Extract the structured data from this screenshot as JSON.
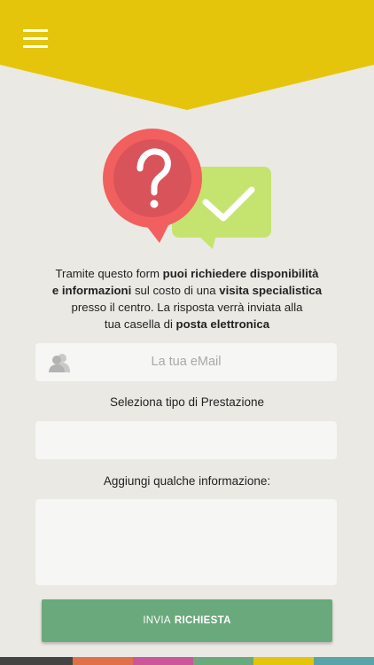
{
  "colors": {
    "header": "#e5c50c",
    "background": "#ebe9e3",
    "field_bg": "#f6f6f5",
    "button": "#6aa97c",
    "bubble_red": "#f25f5f",
    "bubble_green": "#c4e46f",
    "strip": [
      "#444444",
      "#e0704a",
      "#c9579a",
      "#69a97b",
      "#e5c50c",
      "#5aa3a6"
    ]
  },
  "header": {
    "menu_icon": "hamburger-menu-icon"
  },
  "intro": {
    "part1": "Tramite questo form ",
    "bold1": "puoi richiedere disponibilità",
    "bold2": "e informazioni",
    "part2": " sul costo di una ",
    "bold3": "visita specialistica",
    "part3": "presso il centro. La risposta verrà inviata alla",
    "part4": "tua casella di ",
    "bold4": "posta elettronica"
  },
  "form": {
    "email_placeholder": "La tua eMail",
    "prestazione_label": "Seleziona tipo di Prestazione",
    "prestazione_value": "",
    "info_label": "Aggiungi qualche informazione:",
    "info_value": ""
  },
  "submit": {
    "label_regular": "INVIA",
    "label_bold": "RICHIESTA"
  }
}
